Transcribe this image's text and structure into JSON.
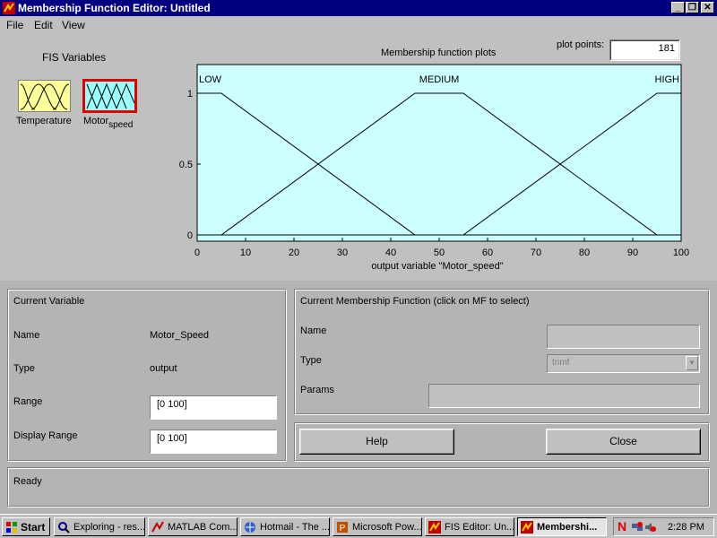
{
  "window": {
    "title": "Membership Function Editor: Untitled"
  },
  "menu": {
    "file": "File",
    "edit": "Edit",
    "view": "View"
  },
  "fis": {
    "heading": "FIS Variables",
    "input_label": "Temperature",
    "output_label_a": "Motor",
    "output_label_b": "speed"
  },
  "plot": {
    "title": "Membership function plots",
    "plot_points_label": "plot points:",
    "plot_points_value": "181"
  },
  "chart_data": {
    "type": "line",
    "xlabel": "output variable \"Motor_speed\"",
    "xlim": [
      0,
      100
    ],
    "ylim": [
      0,
      1
    ],
    "xticks": [
      "0",
      "10",
      "20",
      "30",
      "40",
      "50",
      "60",
      "70",
      "80",
      "90",
      "100"
    ],
    "yticks": [
      "0",
      "0.5",
      "1"
    ],
    "series": [
      {
        "name": "LOW",
        "x": [
          0,
          5,
          45,
          100
        ],
        "y": [
          1,
          1,
          0,
          0
        ]
      },
      {
        "name": "MEDIUM",
        "x": [
          0,
          5,
          45,
          55,
          95,
          100
        ],
        "y": [
          0,
          0,
          1,
          1,
          0,
          0
        ]
      },
      {
        "name": "HIGH",
        "x": [
          0,
          55,
          95,
          100
        ],
        "y": [
          0,
          0,
          1,
          1
        ]
      }
    ],
    "background": "#ccffff"
  },
  "current_variable": {
    "heading": "Current Variable",
    "name_label": "Name",
    "name_value": "Motor_Speed",
    "type_label": "Type",
    "type_value": "output",
    "range_label": "Range",
    "range_value": "[0 100]",
    "display_range_label": "Display Range",
    "display_range_value": "[0 100]"
  },
  "current_mf": {
    "heading": "Current Membership Function (click on MF to select)",
    "name_label": "Name",
    "name_value": "",
    "type_label": "Type",
    "type_value": "trimf",
    "params_label": "Params",
    "params_value": ""
  },
  "buttons": {
    "help": "Help",
    "close": "Close"
  },
  "status": {
    "text": "Ready"
  },
  "taskbar": {
    "start": "Start",
    "tasks": [
      {
        "label": "Exploring - res..."
      },
      {
        "label": "MATLAB Com..."
      },
      {
        "label": "Hotmail - The ..."
      },
      {
        "label": "Microsoft Pow..."
      },
      {
        "label": "FIS Editor: Un..."
      },
      {
        "label": "Membershi..."
      }
    ],
    "clock": "2:28 PM"
  },
  "colors": {
    "title_bar": "#000080",
    "plot_bg": "#ccffff",
    "input_icon": "#ffff99",
    "output_icon": "#99ffff",
    "selected_border": "#e00000"
  }
}
